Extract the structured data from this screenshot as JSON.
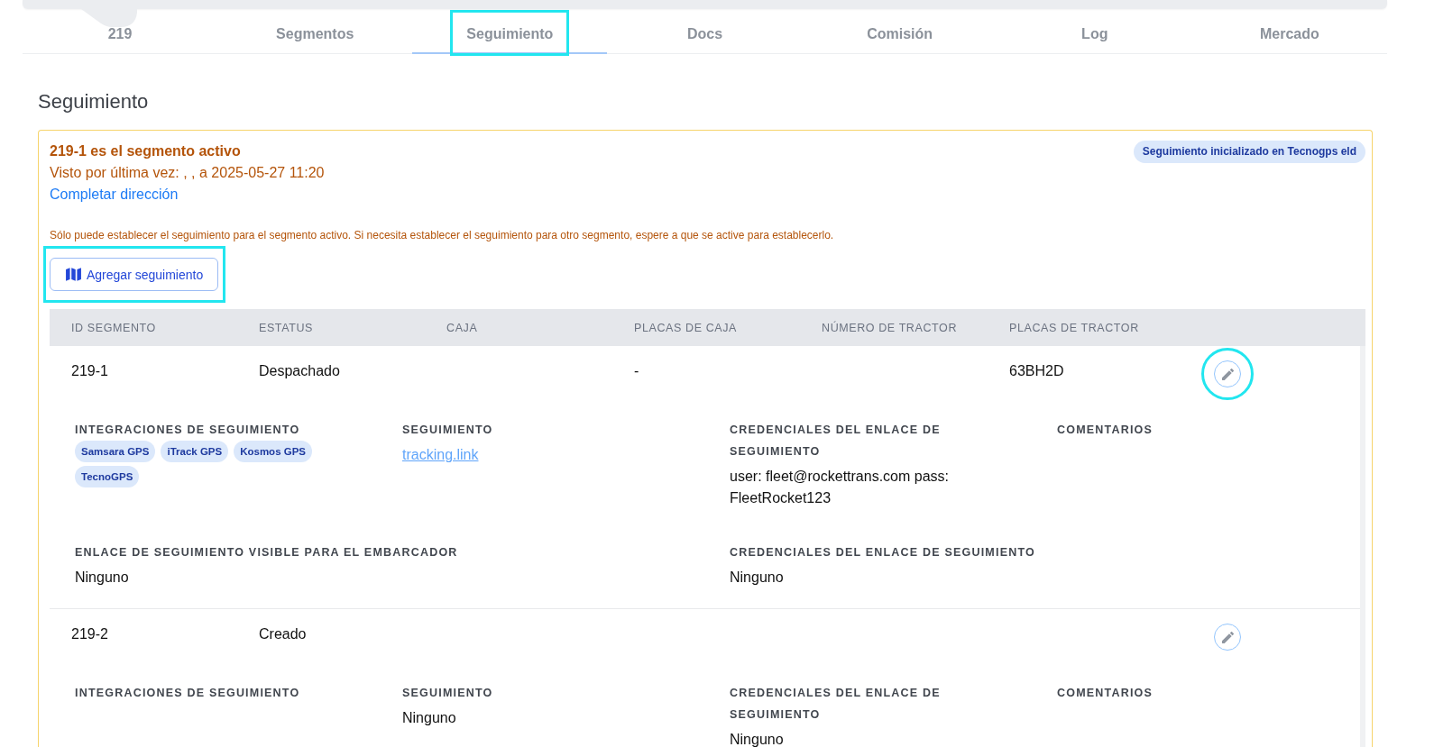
{
  "tabs": [
    {
      "label": "219",
      "selected": false,
      "highlighted": false
    },
    {
      "label": "Segmentos",
      "selected": false,
      "highlighted": false
    },
    {
      "label": "Seguimiento",
      "selected": true,
      "highlighted": true
    },
    {
      "label": "Docs",
      "selected": false,
      "highlighted": false
    },
    {
      "label": "Comisión",
      "selected": false,
      "highlighted": false
    },
    {
      "label": "Log",
      "selected": false,
      "highlighted": false
    },
    {
      "label": "Mercado",
      "selected": false,
      "highlighted": false
    }
  ],
  "section_title": "Seguimiento",
  "tracking_panel": {
    "title": "219-1 es el segmento activo",
    "last_seen": "Visto por última vez: , , a 2025-05-27 11:20",
    "complete_address_link": "Completar dirección",
    "status_badge": "Seguimiento inicializado en Tecnogps eld",
    "notice": "Sólo puede establecer el seguimiento para el segmento activo. Si necesita establecer el seguimiento para otro segmento, espere a que se active para establecerlo.",
    "add_button": {
      "label": "Agregar seguimiento",
      "highlighted": true
    },
    "table": {
      "columns": [
        "ID SEGMENTO",
        "ESTATUS",
        "CAJA",
        "PLACAS DE CAJA",
        "NÚMERO DE TRACTOR",
        "PLACAS DE TRACTOR"
      ],
      "rows": [
        {
          "segment_id": "219-1",
          "status": "Despachado",
          "box_plates": "-",
          "tractor_plates": "63BH2D",
          "edit_button": {
            "highlighted": true
          },
          "details": [
            {
              "kind": "tags",
              "label": "INTEGRACIONES DE SEGUIMIENTO",
              "tags": [
                "Samsara GPS",
                "iTrack GPS",
                "Kosmos GPS",
                "TecnoGPS"
              ]
            },
            {
              "kind": "link",
              "label": "SEGUIMIENTO",
              "value": "tracking.link"
            },
            {
              "kind": "text",
              "label": "CREDENCIALES DEL ENLACE DE SEGUIMIENTO",
              "value": "user: fleet@rockettrans.com pass: FleetRocket123"
            },
            {
              "kind": "text",
              "label": "COMENTARIOS"
            }
          ],
          "extra_details": [
            {
              "label": "ENLACE DE SEGUIMIENTO VISIBLE PARA EL EMBARCADOR",
              "value": "Ninguno"
            },
            {
              "label": "CREDENCIALES DEL ENLACE DE SEGUIMIENTO",
              "value": "Ninguno"
            }
          ]
        },
        {
          "segment_id": "219-2",
          "status": "Creado",
          "edit_button": {
            "highlighted": false
          },
          "details": [
            {
              "kind": "tags",
              "label": "INTEGRACIONES DE SEGUIMIENTO"
            },
            {
              "kind": "text",
              "label": "SEGUIMIENTO",
              "value": "Ninguno"
            },
            {
              "kind": "text",
              "label": "CREDENCIALES DEL ENLACE DE SEGUIMIENTO",
              "value": "Ninguno"
            },
            {
              "kind": "text",
              "label": "COMENTARIOS"
            }
          ]
        }
      ]
    }
  }
}
